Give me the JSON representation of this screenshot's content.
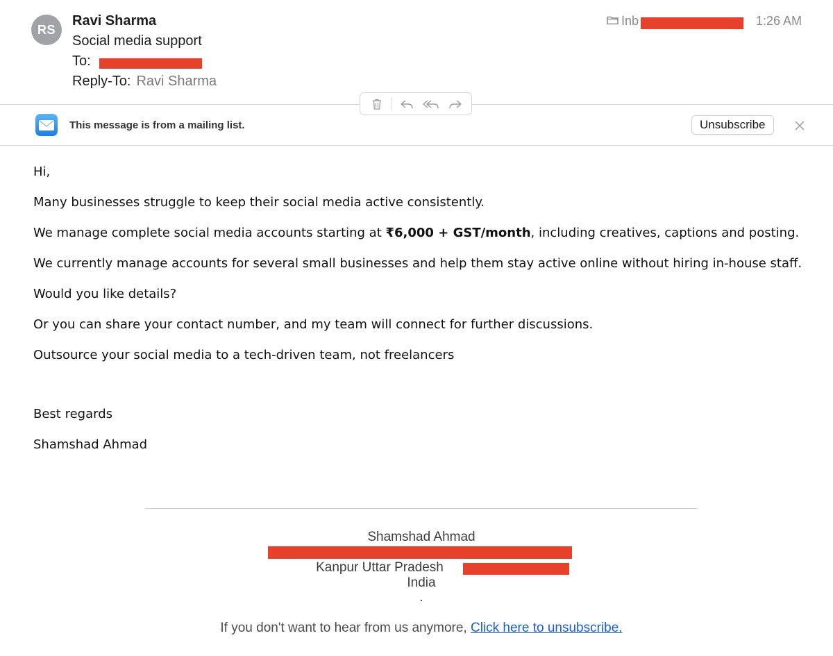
{
  "header": {
    "avatar_initials": "RS",
    "sender_name": "Ravi Sharma",
    "subject": "Social media support",
    "to_label": "To:",
    "reply_to_label": "Reply-To:",
    "reply_to_value": "Ravi Sharma",
    "folder_label": "Inb",
    "time": "1:26 AM"
  },
  "toolbar": {
    "icons": [
      "trash-icon",
      "reply-icon",
      "reply-all-icon",
      "forward-icon"
    ]
  },
  "mailing_list": {
    "notice": "This message is from a mailing list.",
    "unsubscribe_label": "Unsubscribe"
  },
  "body": {
    "greeting": "Hi,",
    "p1": "Many businesses struggle to keep their social media active consistently.",
    "p2_before": "We manage complete social media accounts starting at ",
    "p2_bold": "₹6,000 + GST/month",
    "p2_after": ", including creatives, captions and posting.",
    "p3": "We currently manage accounts for several small businesses and help them stay active online without hiring in-house staff.",
    "p4": "Would you like details?",
    "p5": "Or you can share your contact number, and my team will connect for further discussions.",
    "p6": "Outsource your social media to a tech-driven team, not freelancers",
    "closing": "Best regards",
    "signature": "Shamshad Ahmad"
  },
  "footer": {
    "name": "Shamshad Ahmad",
    "city_line": "Kanpur Uttar Pradesh",
    "country": "India",
    "dot": ".",
    "unsub_text": "If you don't want to hear from us anymore, ",
    "unsub_link": "Click here to unsubscribe."
  },
  "colors": {
    "redaction": "#e8412b",
    "link": "#1a5fd0",
    "avatar": "#a1a2a8",
    "mail_icon": "#2f8de4"
  }
}
